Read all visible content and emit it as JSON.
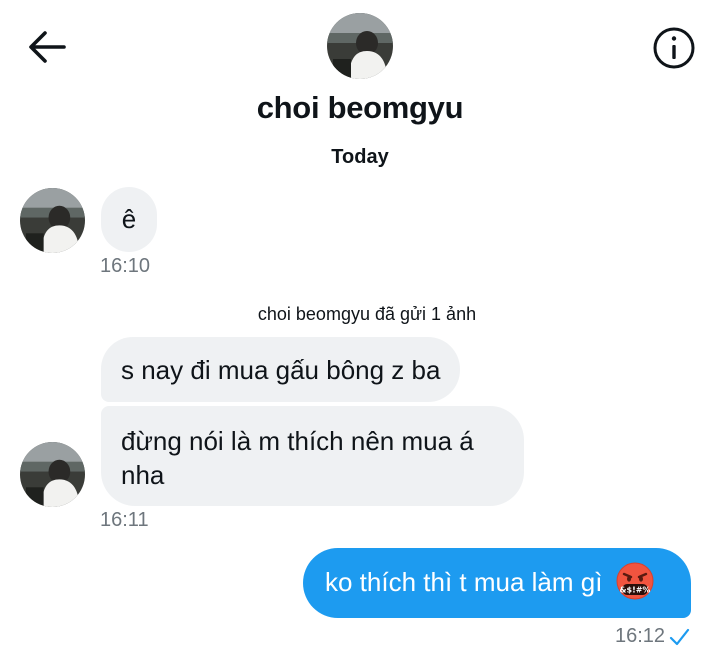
{
  "header": {
    "name": "choi beomgyu",
    "back_icon": "arrow-left-icon",
    "info_icon": "info-circle-icon"
  },
  "conversation": {
    "day_label": "Today",
    "system_note": "choi beomgyu đã gửi 1 ảnh",
    "messages": [
      {
        "from": "other",
        "text": "ê"
      },
      {
        "from": "other",
        "text": "s nay đi mua gấu bông z ba"
      },
      {
        "from": "other",
        "text": "đừng nói là m thích nên mua á nha"
      },
      {
        "from": "me",
        "text": "ko thích thì t mua làm gì",
        "emoji": "angry-face-with-symbols-icon"
      }
    ],
    "timestamps": [
      "16:10",
      "16:11",
      "16:12"
    ]
  },
  "colors": {
    "outgoing_bubble": "#1d9bf0",
    "incoming_bubble": "#eff1f3",
    "read_check": "#1d9bf0"
  }
}
